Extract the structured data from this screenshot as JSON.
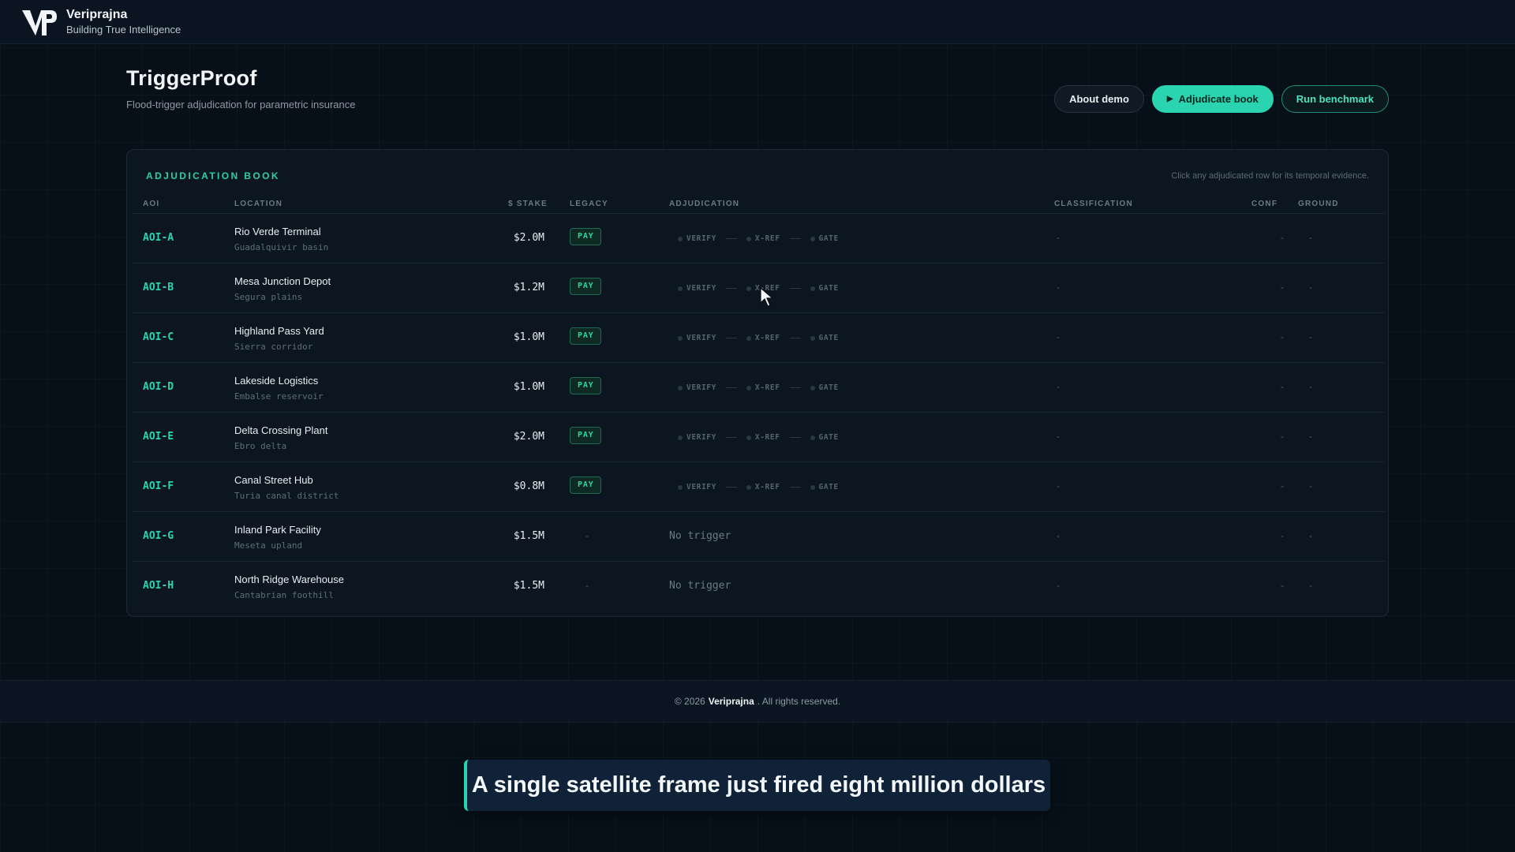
{
  "header": {
    "brand_name": "Veriprajna",
    "brand_tagline": "Building True Intelligence",
    "logo_icon": "vp-monogram-icon"
  },
  "page": {
    "title": "TriggerProof",
    "subtitle": "Flood-trigger adjudication for parametric insurance"
  },
  "actions": {
    "about_label": "About demo",
    "adjudicate_label": "Adjudicate book",
    "benchmark_label": "Run benchmark"
  },
  "book": {
    "title": "ADJUDICATION BOOK",
    "hint": "Click any adjudicated row for its temporal evidence.",
    "columns": {
      "aoi": "AOI",
      "location": "LOCATION",
      "stake": "$ STAKE",
      "legacy": "LEGACY",
      "adjudication": "ADJUDICATION",
      "classification": "CLASSIFICATION",
      "conf": "CONF",
      "ground": "GROUND"
    },
    "steps": [
      "VERIFY",
      "X-REF",
      "GATE"
    ],
    "rows": [
      {
        "aoi": "AOI-A",
        "name": "Rio Verde Terminal",
        "region": "Guadalquivir basin",
        "stake": "$2.0M",
        "legacy": "PAY",
        "adjudication": "",
        "classification": "-",
        "conf": "-",
        "ground": "-"
      },
      {
        "aoi": "AOI-B",
        "name": "Mesa Junction Depot",
        "region": "Segura plains",
        "stake": "$1.2M",
        "legacy": "PAY",
        "adjudication": "",
        "classification": "-",
        "conf": "-",
        "ground": "-"
      },
      {
        "aoi": "AOI-C",
        "name": "Highland Pass Yard",
        "region": "Sierra corridor",
        "stake": "$1.0M",
        "legacy": "PAY",
        "adjudication": "",
        "classification": "-",
        "conf": "-",
        "ground": "-"
      },
      {
        "aoi": "AOI-D",
        "name": "Lakeside Logistics",
        "region": "Embalse reservoir",
        "stake": "$1.0M",
        "legacy": "PAY",
        "adjudication": "",
        "classification": "-",
        "conf": "-",
        "ground": "-"
      },
      {
        "aoi": "AOI-E",
        "name": "Delta Crossing Plant",
        "region": "Ebro delta",
        "stake": "$2.0M",
        "legacy": "PAY",
        "adjudication": "",
        "classification": "-",
        "conf": "-",
        "ground": "-"
      },
      {
        "aoi": "AOI-F",
        "name": "Canal Street Hub",
        "region": "Turia canal district",
        "stake": "$0.8M",
        "legacy": "PAY",
        "adjudication": "",
        "classification": "-",
        "conf": "-",
        "ground": "-"
      },
      {
        "aoi": "AOI-G",
        "name": "Inland Park Facility",
        "region": "Meseta upland",
        "stake": "$1.5M",
        "legacy": "-",
        "adjudication": "No trigger",
        "classification": "-",
        "conf": "-",
        "ground": "-"
      },
      {
        "aoi": "AOI-H",
        "name": "North Ridge Warehouse",
        "region": "Cantabrian foothill",
        "stake": "$1.5M",
        "legacy": "-",
        "adjudication": "No trigger",
        "classification": "-",
        "conf": "-",
        "ground": "-"
      }
    ]
  },
  "footer": {
    "prefix": "© 2026",
    "brand": "Veriprajna",
    "suffix": ". All rights reserved."
  },
  "caption": "A single satellite frame just fired eight million dollars",
  "colors": {
    "accent": "#2bd4b0",
    "background": "#071018",
    "pay_badge": "#35d39f"
  }
}
